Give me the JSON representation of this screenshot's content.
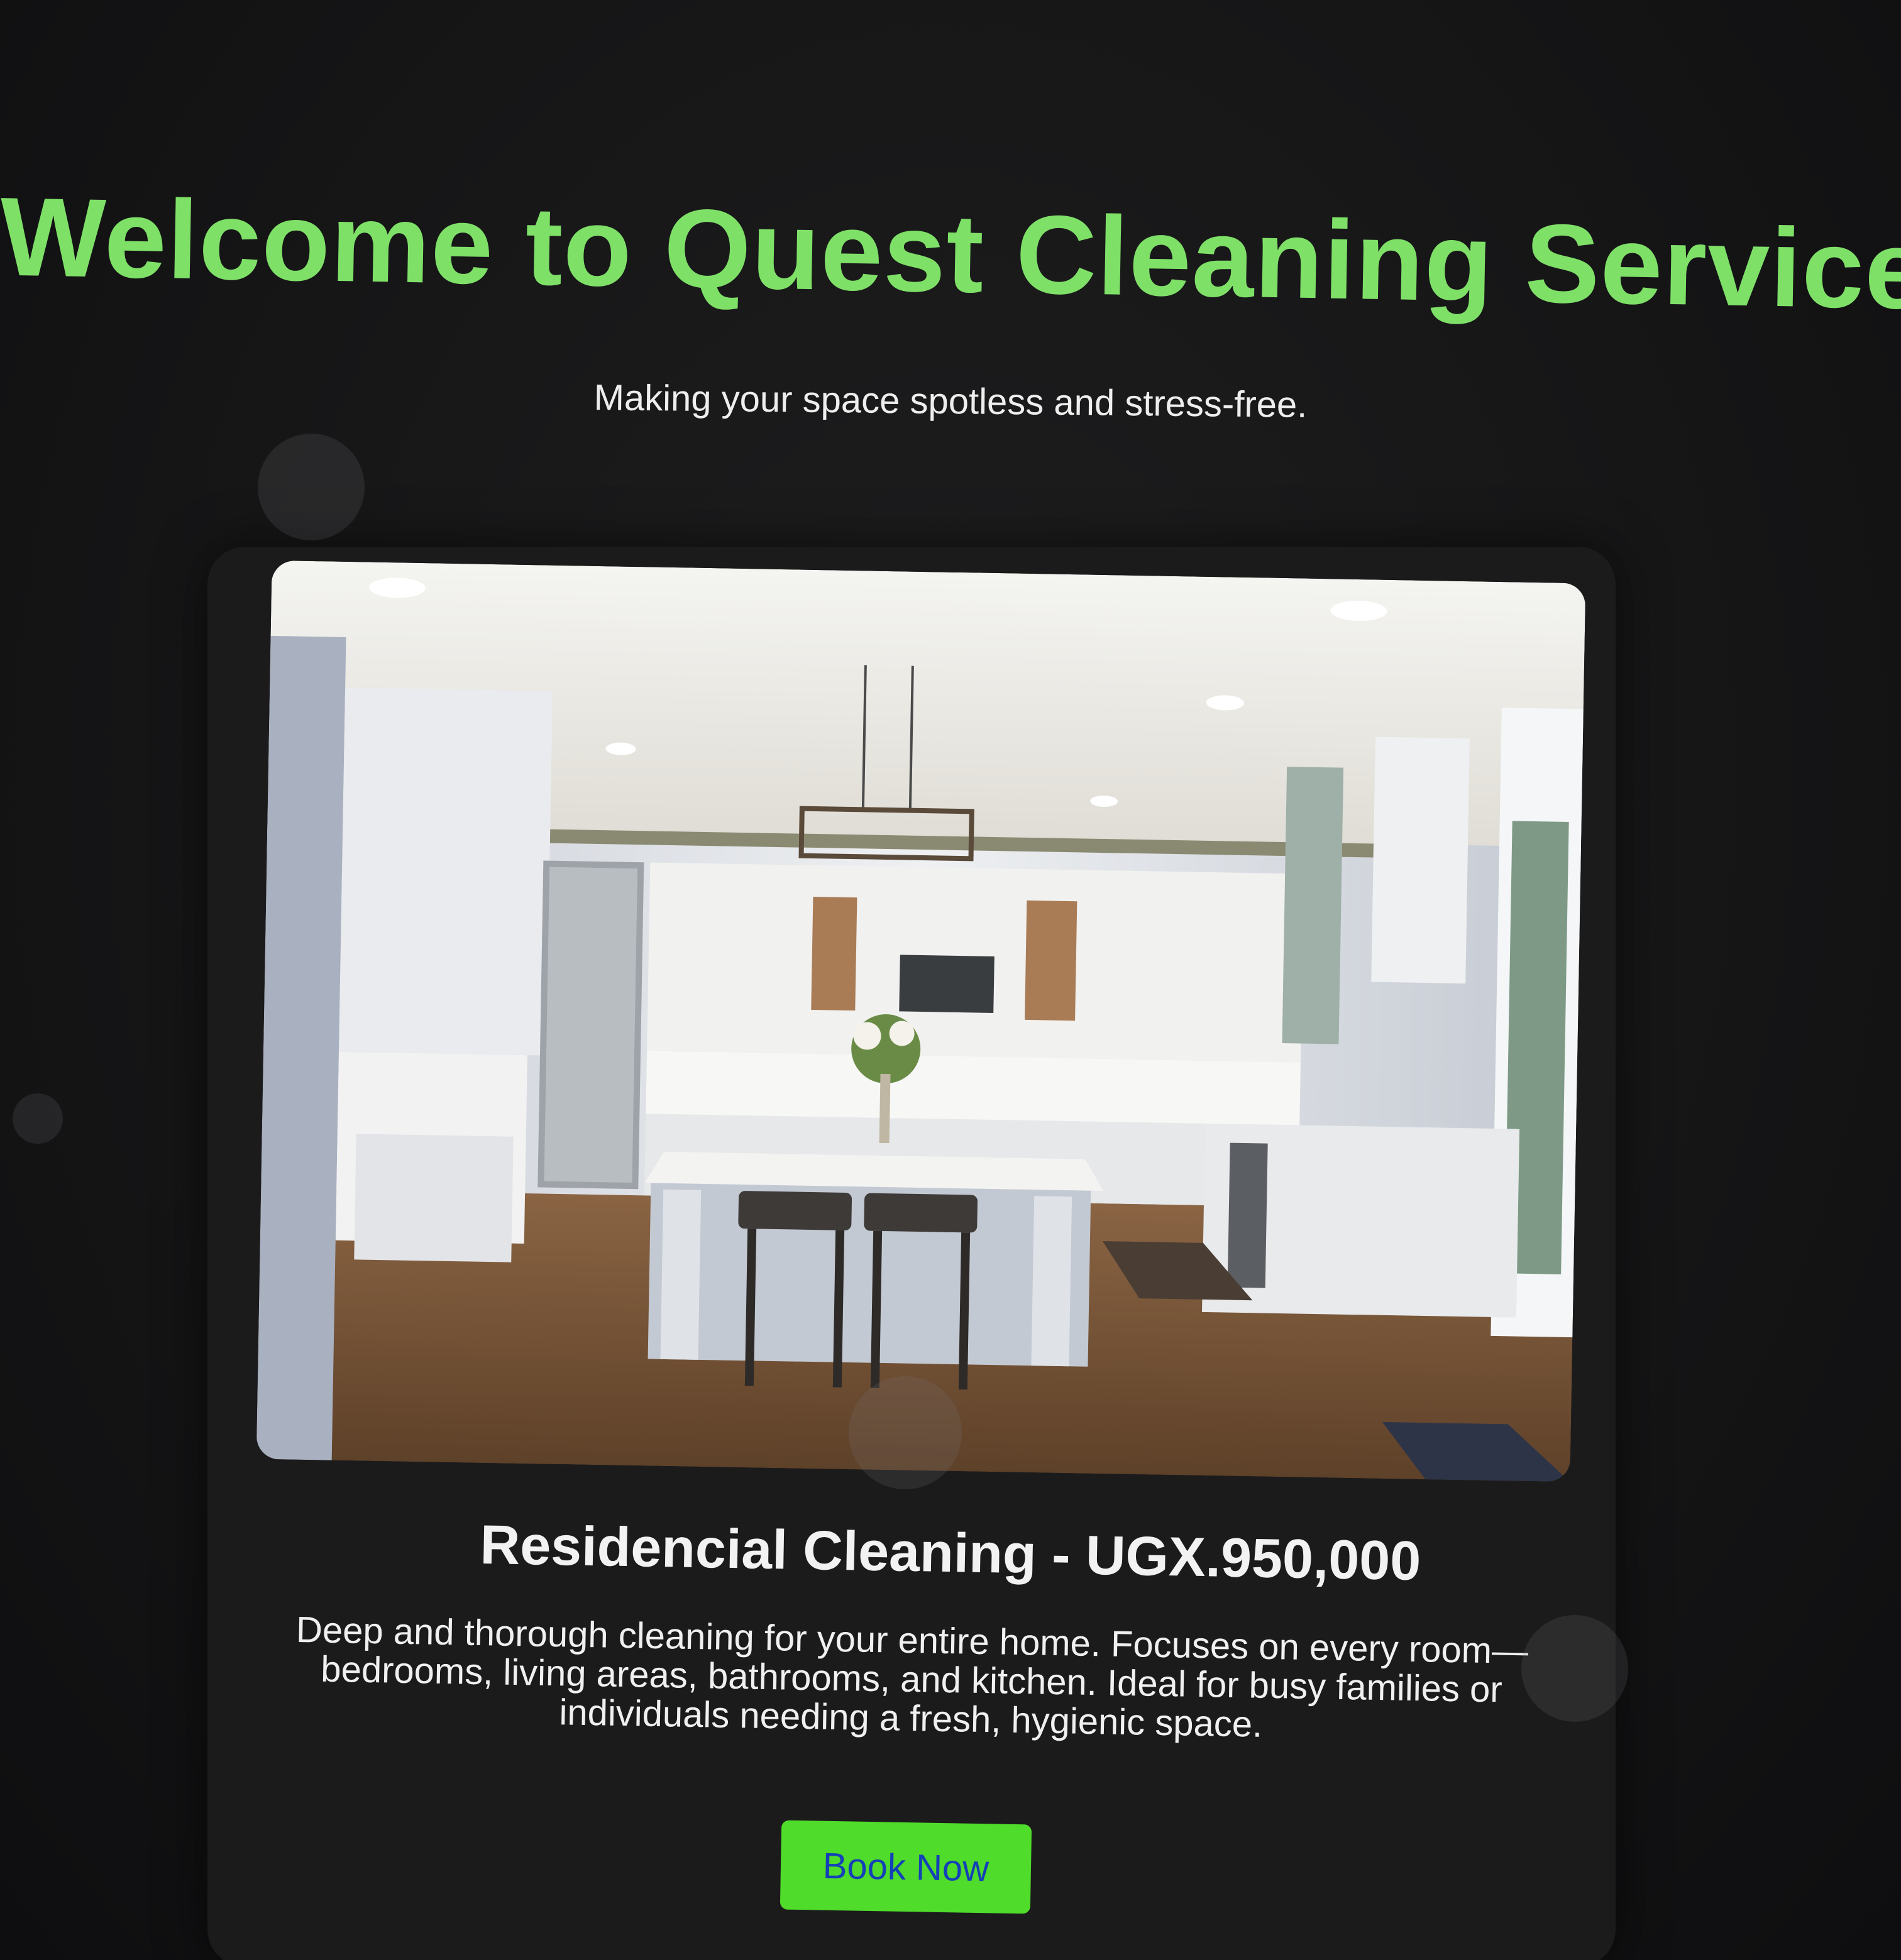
{
  "hero": {
    "title": "Welcome to Quest Cleaning Services",
    "subtitle": "Making your space spotless and stress-free."
  },
  "service": {
    "image_alt": "Bright white kitchen with island and bar stools",
    "heading": "Residencial Cleaning - UGX.950,000",
    "description": "Deep and thorough cleaning for your entire home. Focuses on every room—bedrooms, living areas, bathrooms, and kitchen. Ideal for busy families or individuals needing a fresh, hygienic space.",
    "button_label": "Book Now"
  },
  "colors": {
    "background": "#151515",
    "title_green": "#7fe068",
    "button_green": "#4fdc2a",
    "button_text_blue": "#1440b8"
  }
}
